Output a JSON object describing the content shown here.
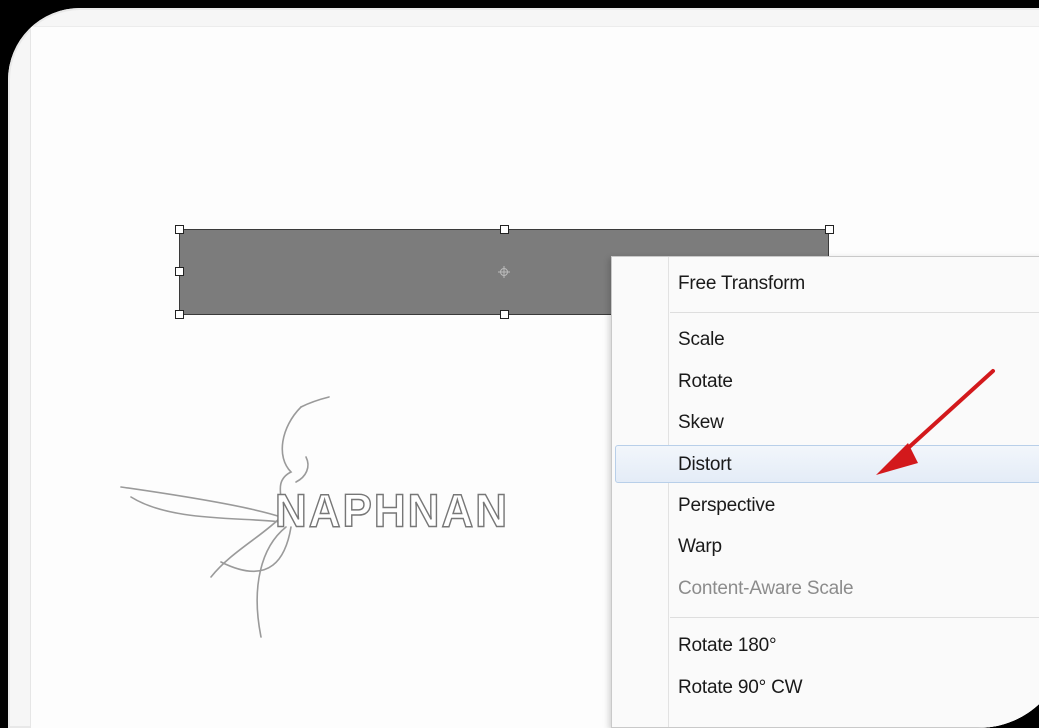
{
  "context_menu": {
    "items": [
      {
        "label": "Free Transform"
      },
      {
        "label": "Scale"
      },
      {
        "label": "Rotate"
      },
      {
        "label": "Skew"
      },
      {
        "label": "Distort",
        "highlighted": true
      },
      {
        "label": "Perspective"
      },
      {
        "label": "Warp"
      },
      {
        "label": "Content-Aware Scale",
        "disabled": true
      },
      {
        "label": "Rotate 180°"
      },
      {
        "label": "Rotate 90° CW"
      }
    ]
  },
  "watermark": {
    "text": "NAPHNAN"
  },
  "colors": {
    "shape_fill": "#7c7c7c",
    "menu_highlight": "#e4ecf7",
    "annotation_arrow": "#d3191c"
  },
  "icons": [
    "transform-handle",
    "reference-point-icon",
    "annotation-arrow-icon",
    "bird-logo-icon"
  ]
}
